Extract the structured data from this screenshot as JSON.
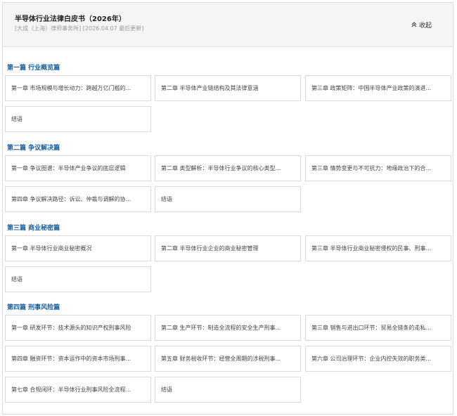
{
  "header": {
    "title": "半导体行业法律白皮书（2026年）",
    "subtitle": "[大成（上海）律师事务所] [2026.04.07 最后更新]",
    "collapse_label": "收起",
    "collapse_icon": "double-chevron-up-icon"
  },
  "sections": [
    {
      "title": "第一篇 行业概览篇",
      "items": [
        "第一章 市场规模与增长动力：跨越万亿门槛的...",
        "第二章 半导体产业链结构及其法律意涵",
        "第三章 政策矩阵：中国半导体产业政策的演进...",
        "结语"
      ]
    },
    {
      "title": "第二篇 争议解决篇",
      "items": [
        "第一章 争议图谱：半导体产业争议的底层逻辑",
        "第二章 类型解析：半导体行业争议的核心类型...",
        "第三章 情势变更与不可抗力：地缘政治下的合...",
        "第四章 争议解决路径：诉讼、仲裁与调解的协...",
        "结语"
      ]
    },
    {
      "title": "第三篇 商业秘密篇",
      "items": [
        "第一章 半导体行业商业秘密概况",
        "第二章 半导体行业企业的商业秘密管理",
        "第三章 半导体行业商业秘密侵权的民事、刑事...",
        "结语"
      ]
    },
    {
      "title": "第四篇 刑事风险篇",
      "items": [
        "第一章 研发环节：技术源头的知识产权刑事风险",
        "第二章 生产环节：制造全流程的安全生产刑事...",
        "第三章 销售与进出口环节：贸易全链条的走私...",
        "第四章 融资环节：资本运作中的资本市场刑事...",
        "第五章 财务税收环节：经营全周期的涉税刑事...",
        "第六章 公司治理环节：企业内控失效的职务类...",
        "第七章 合规闭环：半导体行业刑事风险全流程...",
        "结语"
      ]
    }
  ]
}
